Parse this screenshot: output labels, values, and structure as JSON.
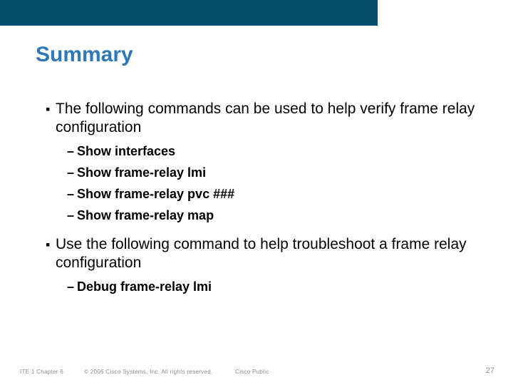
{
  "title": "Summary",
  "bullets": [
    {
      "text": "The following commands can be used to help verify frame relay configuration",
      "subs": [
        "Show interfaces",
        "Show frame-relay lmi",
        "Show frame-relay pvc ###",
        "Show frame-relay map"
      ]
    },
    {
      "text": "Use the following command to help troubleshoot a frame relay configuration",
      "subs": [
        "Debug frame-relay lmi"
      ]
    }
  ],
  "footer": {
    "left": "ITE 1 Chapter 6",
    "copyright": "© 2006 Cisco Systems, Inc. All rights reserved.",
    "public": "Cisco Public",
    "page": "27"
  }
}
